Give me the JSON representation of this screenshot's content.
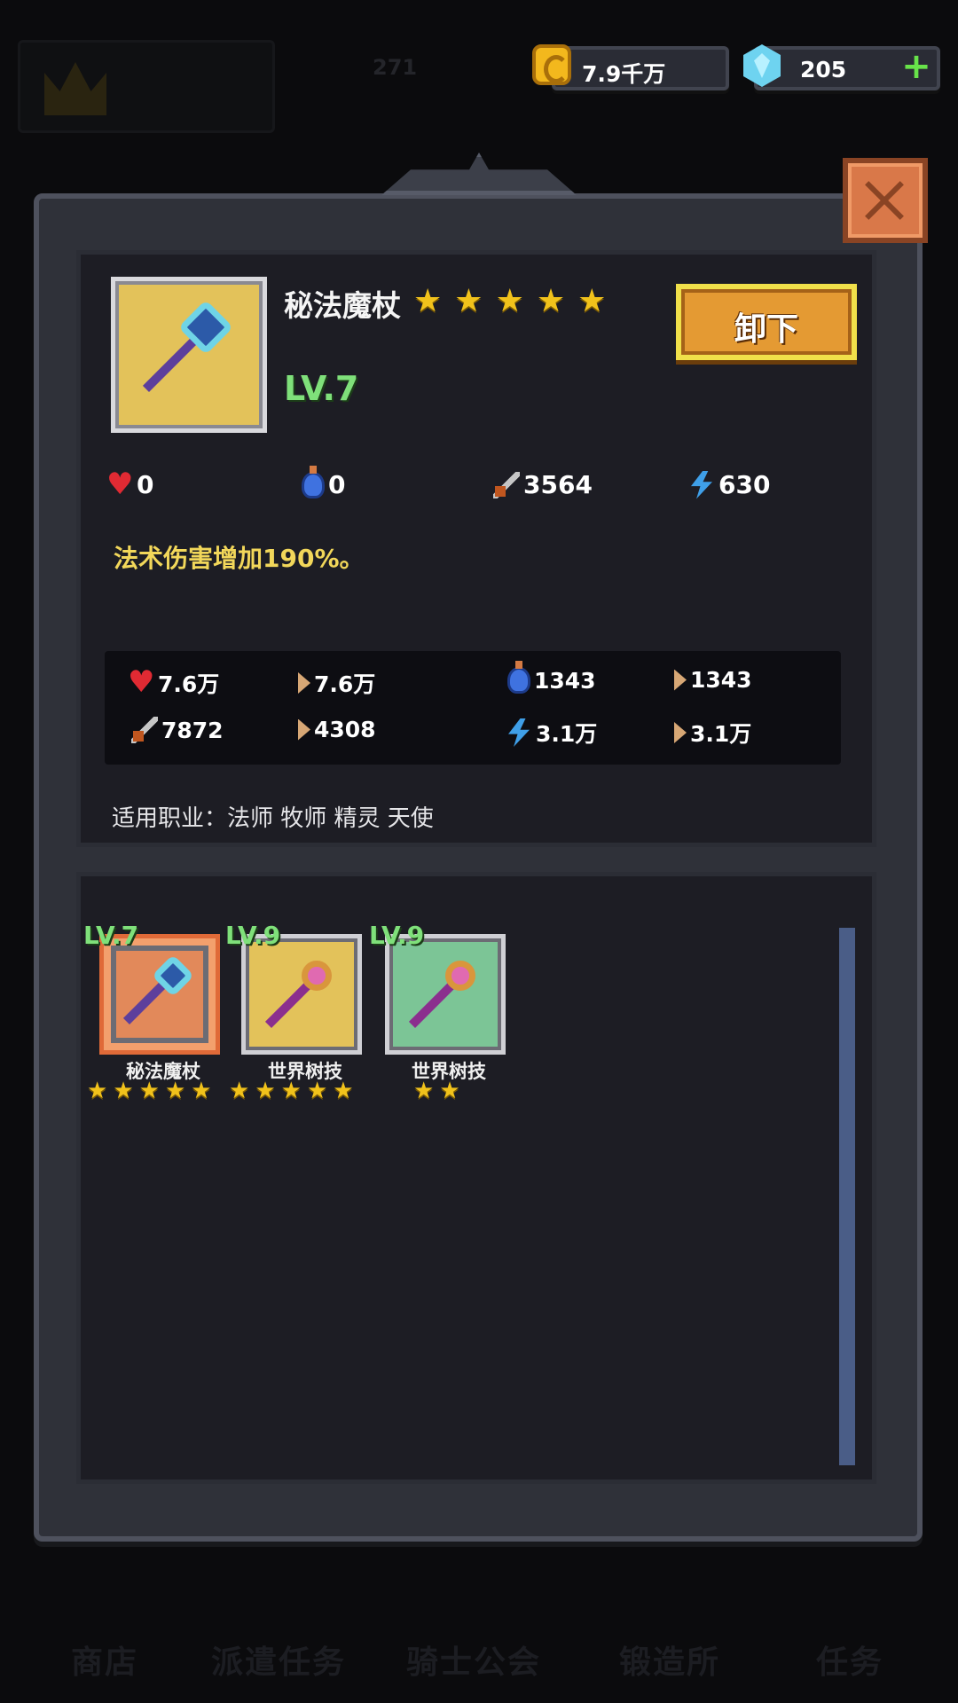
{
  "background": {
    "top_value": "271",
    "bottom_nav": [
      "商店",
      "派遣任务",
      "骑士公会",
      "锻造所",
      "任务"
    ]
  },
  "currency": {
    "gold": "7.9千万",
    "gems": "205"
  },
  "equipped": {
    "name": "秘法魔杖",
    "stars": 5,
    "level": "LV.7",
    "unequip_label": "卸下",
    "stats": {
      "hp": "0",
      "mp": "0",
      "atk": "3564",
      "magic": "630"
    },
    "effect": "法术伤害增加190%。"
  },
  "totals": {
    "hp": "7.6万",
    "hp_base": "7.6万",
    "mp": "1343",
    "mp_base": "1343",
    "atk": "7872",
    "atk_base": "4308",
    "magic": "3.1万",
    "magic_base": "3.1万"
  },
  "jobs_text": "适用职业：法师 牧师 精灵 天使",
  "inventory": [
    {
      "name": "秘法魔杖",
      "level": "LV.7",
      "stars": 5,
      "bg": "#e2895a",
      "selected": true
    },
    {
      "name": "世界树技",
      "level": "LV.9",
      "stars": 5,
      "bg": "#e3c25a",
      "selected": false
    },
    {
      "name": "世界树技",
      "level": "LV.9",
      "stars": 2,
      "bg": "#7cc596",
      "selected": false
    }
  ],
  "colors": {
    "star": "#f1c21b",
    "level_green": "#7fe07a",
    "effect_yellow": "#f2d75a",
    "button_orange": "#e49a33"
  }
}
